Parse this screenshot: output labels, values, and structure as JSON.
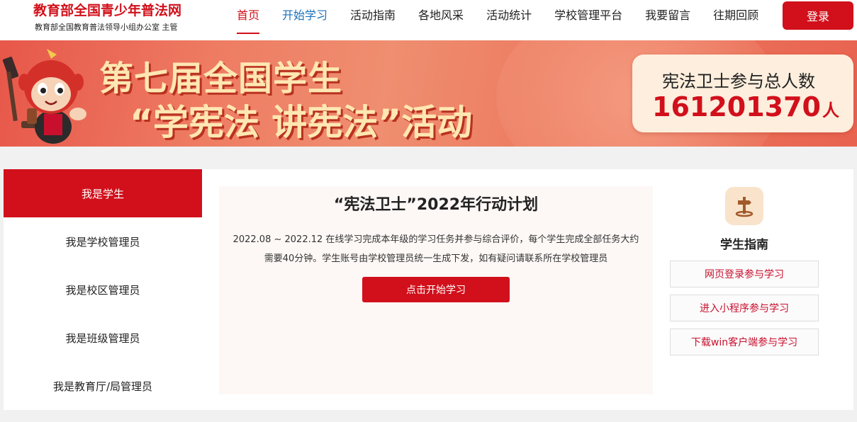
{
  "header": {
    "site_title": "教育部全国青少年普法网",
    "site_subtitle": "教育部全国教育普法领导小组办公室 主管",
    "nav": [
      {
        "label": "首页"
      },
      {
        "label": "开始学习"
      },
      {
        "label": "活动指南"
      },
      {
        "label": "各地风采"
      },
      {
        "label": "活动统计"
      },
      {
        "label": "学校管理平台"
      },
      {
        "label": "我要留言"
      },
      {
        "label": "往期回顾"
      }
    ],
    "login_label": "登录"
  },
  "banner": {
    "line1": "第七届全国学生",
    "line2": "“学宪法 讲宪法”活动",
    "count_label": "宪法卫士参与总人数",
    "count_value": "161201370",
    "count_unit": "人"
  },
  "sidebar": {
    "roles": [
      {
        "label": "我是学生"
      },
      {
        "label": "我是学校管理员"
      },
      {
        "label": "我是校区管理员"
      },
      {
        "label": "我是班级管理员"
      },
      {
        "label": "我是教育厅/局管理员"
      }
    ]
  },
  "plan": {
    "title": "“宪法卫士”2022年行动计划",
    "desc_line1": "2022.08 ~ 2022.12 在线学习完成本年级的学习任务并参与综合评价，每个学生完成全部任务大约",
    "desc_line2": "需要40分钟。学生账号由学校管理员统一生成下发，如有疑问请联系所在学校管理员",
    "start_label": "点击开始学习"
  },
  "guide": {
    "title": "学生指南",
    "buttons": [
      {
        "label": "网页登录参与学习"
      },
      {
        "label": "进入小程序参与学习"
      },
      {
        "label": "下载win客户端参与学习"
      }
    ]
  },
  "colors": {
    "brand_red": "#d1101b",
    "nav_highlight": "#1a6fb8"
  }
}
